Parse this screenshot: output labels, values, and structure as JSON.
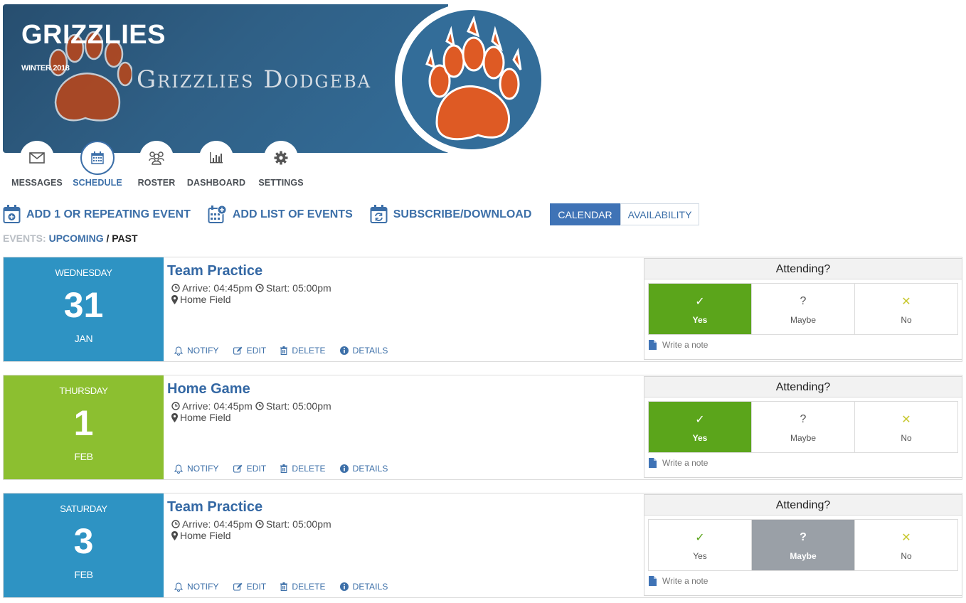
{
  "banner": {
    "team_name": "GRIZZLIES",
    "season": "WINTER 2018",
    "banner_text": "Grizzlies Dodgeba"
  },
  "nav": [
    {
      "label": "MESSAGES",
      "icon": "envelope-icon",
      "active": false
    },
    {
      "label": "SCHEDULE",
      "icon": "calendar-icon",
      "active": true
    },
    {
      "label": "ROSTER",
      "icon": "users-icon",
      "active": false
    },
    {
      "label": "DASHBOARD",
      "icon": "bar-chart-icon",
      "active": false
    },
    {
      "label": "SETTINGS",
      "icon": "gear-icon",
      "active": false
    }
  ],
  "actions": {
    "add_event": "ADD 1 OR REPEATING EVENT",
    "add_list": "ADD LIST OF EVENTS",
    "subscribe": "SUBSCRIBE/DOWNLOAD",
    "view_toggle": {
      "calendar": "CALENDAR",
      "availability": "AVAILABILITY",
      "selected": "CALENDAR"
    }
  },
  "filter": {
    "label": "EVENTS:",
    "upcoming": "UPCOMING",
    "separator": " / ",
    "past": "PAST"
  },
  "colors": {
    "primary": "#3c6fa8",
    "practice": "#2e93c3",
    "game": "#8cbf30",
    "yes_selected": "#5ba51b",
    "maybe_selected": "#9aa0a7"
  },
  "event_links": {
    "notify": "NOTIFY",
    "edit": "EDIT",
    "delete": "DELETE",
    "details": "DETAILS"
  },
  "attendance": {
    "heading": "Attending?",
    "yes": "Yes",
    "maybe": "Maybe",
    "no": "No",
    "yes_glyph": "✓",
    "maybe_glyph": "?",
    "no_glyph": "✕",
    "note": "Write a note"
  },
  "events": [
    {
      "weekday": "WEDNESDAY",
      "day": "31",
      "month": "JAN",
      "title": "Team Practice",
      "times": "Arrive: 04:45pm",
      "start": "Start: 05:00pm",
      "location": "Home Field",
      "type": "practice",
      "rsvp": "yes"
    },
    {
      "weekday": "THURSDAY",
      "day": "1",
      "month": "FEB",
      "title": "Home Game",
      "times": "Arrive: 04:45pm",
      "start": "Start: 05:00pm",
      "location": "Home Field",
      "type": "game",
      "rsvp": "yes"
    },
    {
      "weekday": "SATURDAY",
      "day": "3",
      "month": "FEB",
      "title": "Team Practice",
      "times": "Arrive: 04:45pm",
      "start": "Start: 05:00pm",
      "location": "Home Field",
      "type": "practice",
      "rsvp": "maybe"
    }
  ]
}
